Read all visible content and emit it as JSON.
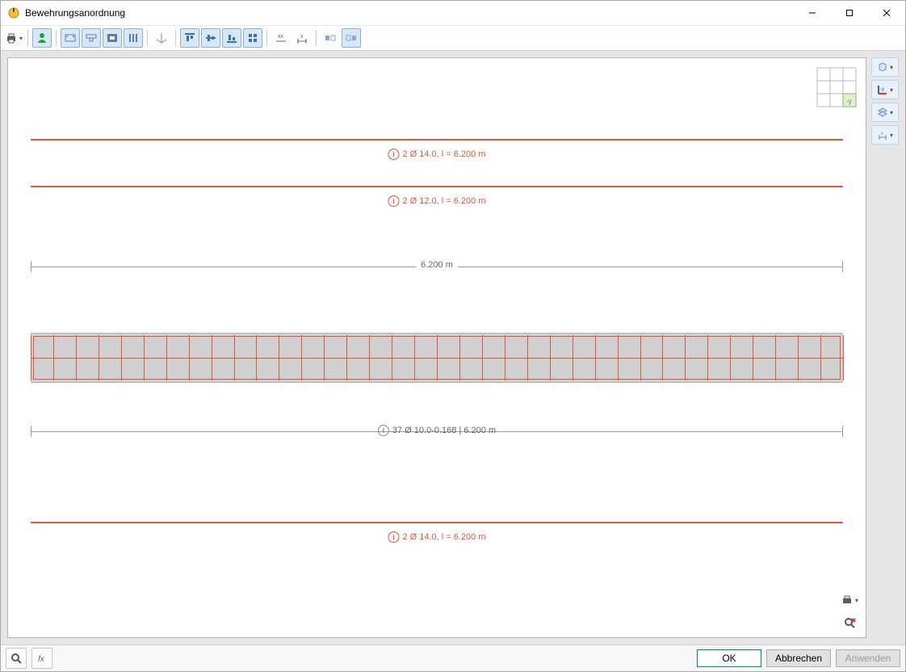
{
  "window": {
    "title": "Bewehrungsanordnung"
  },
  "rebars": {
    "top1": "2 Ø 14.0, l =  6.200 m",
    "top2": "2 Ø 12.0, l =  6.200 m",
    "span_dim": "6.200 m",
    "stirrups": "37 Ø 10.0-0.168 | 6.200 m",
    "bottom": "2 Ø 14.0, l =  6.200 m",
    "stirrup_count": 37
  },
  "dialog": {
    "ok": "OK",
    "cancel": "Abbrechen",
    "apply": "Anwenden"
  }
}
